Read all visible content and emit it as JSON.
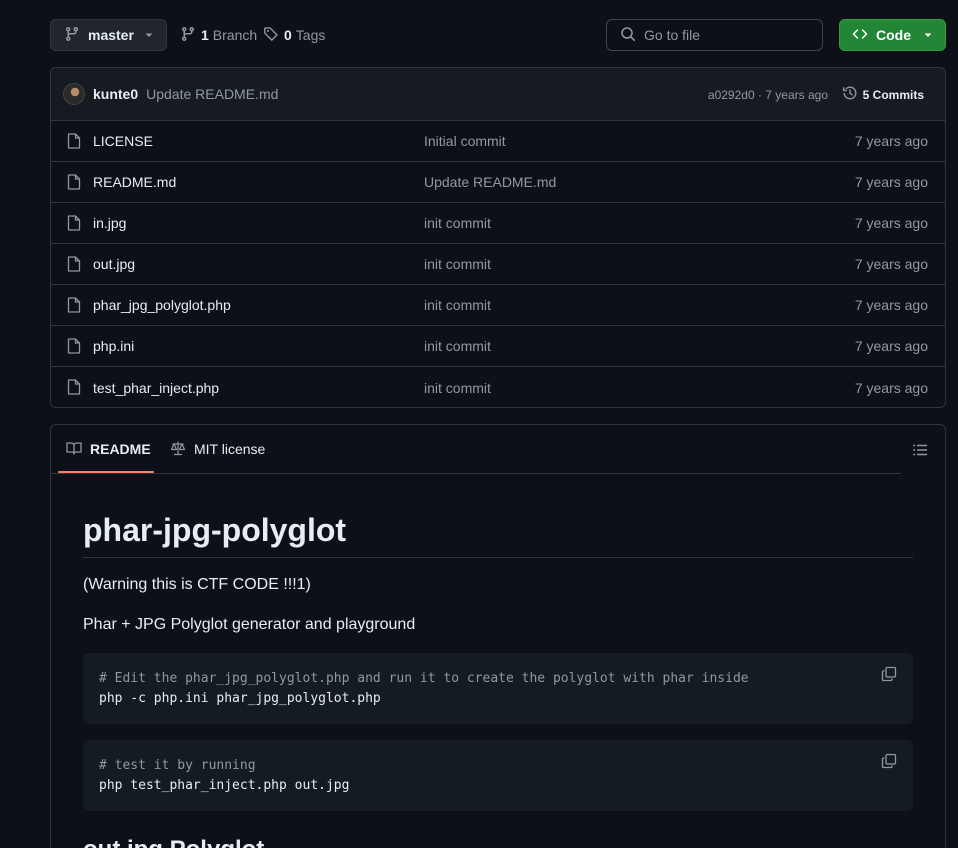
{
  "toolbar": {
    "branch_name": "master",
    "branches_count": "1",
    "branches_label": "Branch",
    "tags_count": "0",
    "tags_label": "Tags",
    "search_placeholder": "Go to file",
    "code_label": "Code"
  },
  "latest_commit": {
    "author": "kunte0",
    "message": "Update README.md",
    "sha_age": "a0292d0 · 7 years ago",
    "commits_label": "5 Commits"
  },
  "files": [
    {
      "name": "LICENSE",
      "message": "Initial commit",
      "age": "7 years ago"
    },
    {
      "name": "README.md",
      "message": "Update README.md",
      "age": "7 years ago"
    },
    {
      "name": "in.jpg",
      "message": "init commit",
      "age": "7 years ago"
    },
    {
      "name": "out.jpg",
      "message": "init commit",
      "age": "7 years ago"
    },
    {
      "name": "phar_jpg_polyglot.php",
      "message": "init commit",
      "age": "7 years ago"
    },
    {
      "name": "php.ini",
      "message": "init commit",
      "age": "7 years ago"
    },
    {
      "name": "test_phar_inject.php",
      "message": "init commit",
      "age": "7 years ago"
    }
  ],
  "readme": {
    "tab_readme": "README",
    "tab_license": "MIT license",
    "title": "phar-jpg-polyglot",
    "para1": "(Warning this is CTF CODE !!!1)",
    "para2": "Phar + JPG Polyglot generator and playground",
    "code1_comment": "# Edit the phar_jpg_polyglot.php and run it to create the polyglot with phar inside",
    "code1_cmd": "php -c php.ini phar_jpg_polyglot.php",
    "code2_comment": "# test it by running",
    "code2_cmd": "php test_phar_inject.php out.jpg",
    "heading2": "out.jpg Polyglot"
  },
  "colors": {
    "background": "#0d1117",
    "accent_green": "#238636",
    "tab_underline": "#f78166"
  }
}
